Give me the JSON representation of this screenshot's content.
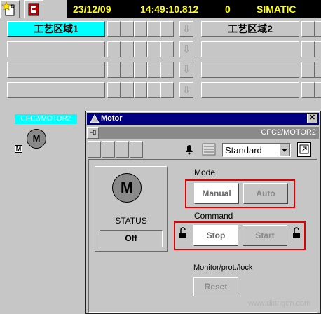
{
  "toolbar": {
    "icons": [
      "new-document-icon",
      "exit-icon"
    ]
  },
  "status_bar": {
    "date": "23/12/09",
    "time": "14:49:10.812",
    "count": "0",
    "system": "SIMATIC"
  },
  "areas": {
    "area1_label": "工艺区域1",
    "area2_label": "工艺区域2"
  },
  "plant": {
    "block_tag": "CFC2/MOTOR2",
    "motor_symbol": "M",
    "mode_indicator": "M"
  },
  "faceplate": {
    "title": "Motor",
    "path": "CFC2/MOTOR2",
    "close_glyph": "✕",
    "view_select": "Standard",
    "motor_symbol": "M",
    "status_label": "STATUS",
    "status_value": "Off",
    "mode_label": "Mode",
    "manual_button": "Manual",
    "auto_button": "Auto",
    "command_label": "Command",
    "stop_button": "Stop",
    "start_button": "Start",
    "monitor_label": "Monitor/prot./lock",
    "reset_button": "Reset"
  },
  "colors": {
    "status_bar_bg": "#000000",
    "status_bar_text": "#ffff00",
    "active_area": "#00ffff",
    "highlight_frame": "#e00000",
    "title_bar": "#000080"
  },
  "watermark": "www.diangon.com"
}
